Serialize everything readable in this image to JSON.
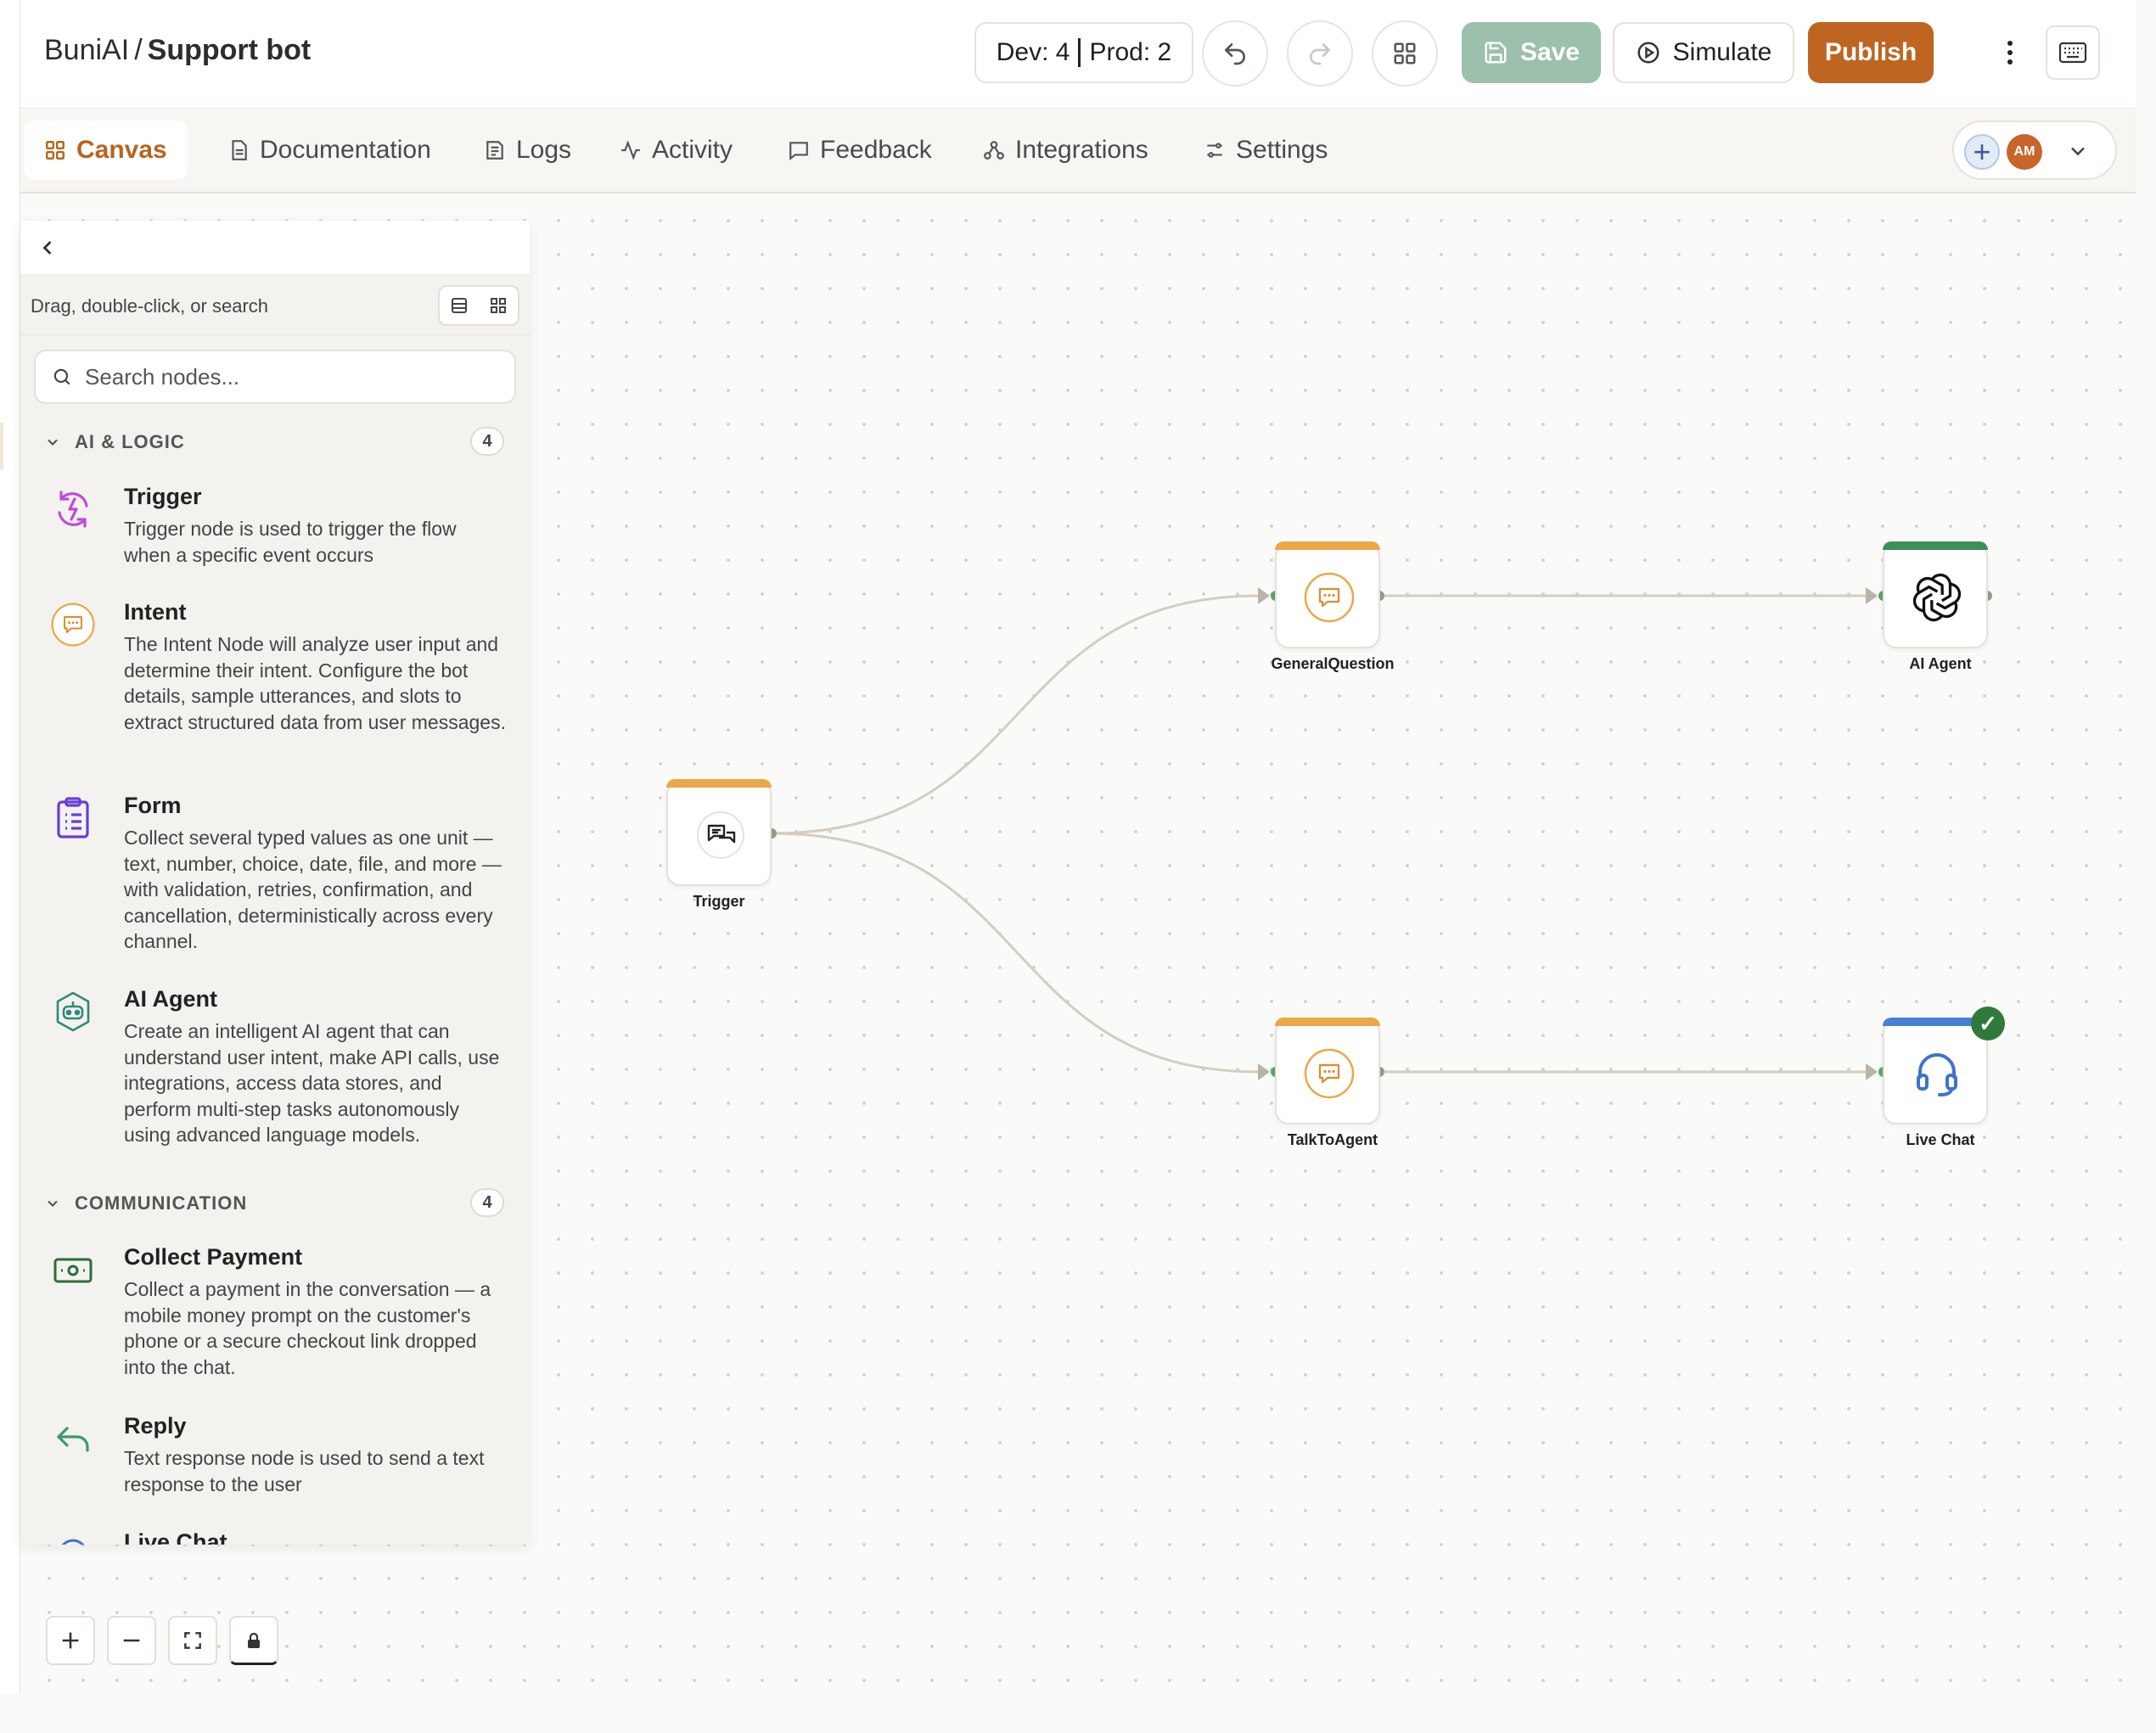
{
  "breadcrumb": {
    "workspace": "BuniAI",
    "separator": "/",
    "bot": "Support bot"
  },
  "versions": {
    "dev": "Dev: 4",
    "prod": "Prod: 2"
  },
  "toolbar": {
    "save": "Save",
    "simulate": "Simulate",
    "publish": "Publish"
  },
  "tabs": [
    {
      "label": "Canvas",
      "icon": "grid-icon",
      "active": true
    },
    {
      "label": "Documentation",
      "icon": "document-icon"
    },
    {
      "label": "Logs",
      "icon": "logs-icon"
    },
    {
      "label": "Activity",
      "icon": "activity-icon"
    },
    {
      "label": "Feedback",
      "icon": "message-square-icon"
    },
    {
      "label": "Integrations",
      "icon": "integrations-icon"
    },
    {
      "label": "Settings",
      "icon": "sliders-icon"
    }
  ],
  "user": {
    "initials": "AM"
  },
  "panel": {
    "hint": "Drag, double-click, or search",
    "search_placeholder": "Search nodes...",
    "sections": [
      {
        "title": "AI & LOGIC",
        "count": "4",
        "items": [
          {
            "title": "Trigger",
            "desc": "Trigger node is used to trigger the flow when a specific event occurs",
            "icon": "lightning-refresh-icon"
          },
          {
            "title": "Intent",
            "desc": "The Intent Node will analyze user input and determine their intent. Configure the bot details, sample utterances, and slots to extract structured data from user messages.",
            "icon": "chat-bubble-icon"
          },
          {
            "title": "Form",
            "desc": "Collect several typed values as one unit — text, number, choice, date, file, and more — with validation, retries, confirmation, and cancellation, deterministically across every channel.",
            "icon": "clipboard-icon"
          },
          {
            "title": "AI Agent",
            "desc": "Create an intelligent AI agent that can understand user intent, make API calls, use integrations, access data stores, and perform multi-step tasks autonomously using advanced language models.",
            "icon": "robot-icon"
          }
        ]
      },
      {
        "title": "COMMUNICATION",
        "count": "4",
        "items": [
          {
            "title": "Collect Payment",
            "desc": "Collect a payment in the conversation — a mobile money prompt on the customer's phone or a secure checkout link dropped into the chat.",
            "icon": "banknote-icon"
          },
          {
            "title": "Reply",
            "desc": "Text response node is used to send a text response to the user",
            "icon": "reply-arrow-icon"
          },
          {
            "title": "Live Chat",
            "desc": "",
            "icon": "headset-icon"
          }
        ]
      }
    ]
  },
  "flow": {
    "nodes": [
      {
        "id": "trigger",
        "label": "Trigger",
        "icon": "chat-bubbles-icon",
        "accent": "#e9a84a"
      },
      {
        "id": "general",
        "label": "GeneralQuestion",
        "icon": "chat-bubble-icon",
        "accent": "#e9a84a"
      },
      {
        "id": "agent",
        "label": "AI Agent",
        "icon": "openai-icon",
        "accent": "#3f8f5a"
      },
      {
        "id": "talk",
        "label": "TalkToAgent",
        "icon": "chat-bubble-icon",
        "accent": "#e9a84a"
      },
      {
        "id": "livechat",
        "label": "Live Chat",
        "icon": "headset-icon",
        "accent": "#4a7fd6",
        "status": "ok"
      }
    ]
  },
  "colors": {
    "accent": "#bf6522",
    "save_disabled": "#9dc0ac",
    "intent_orange": "#e9a84a",
    "agent_green": "#3f8f5a",
    "livechat_blue": "#4a7fd6"
  }
}
